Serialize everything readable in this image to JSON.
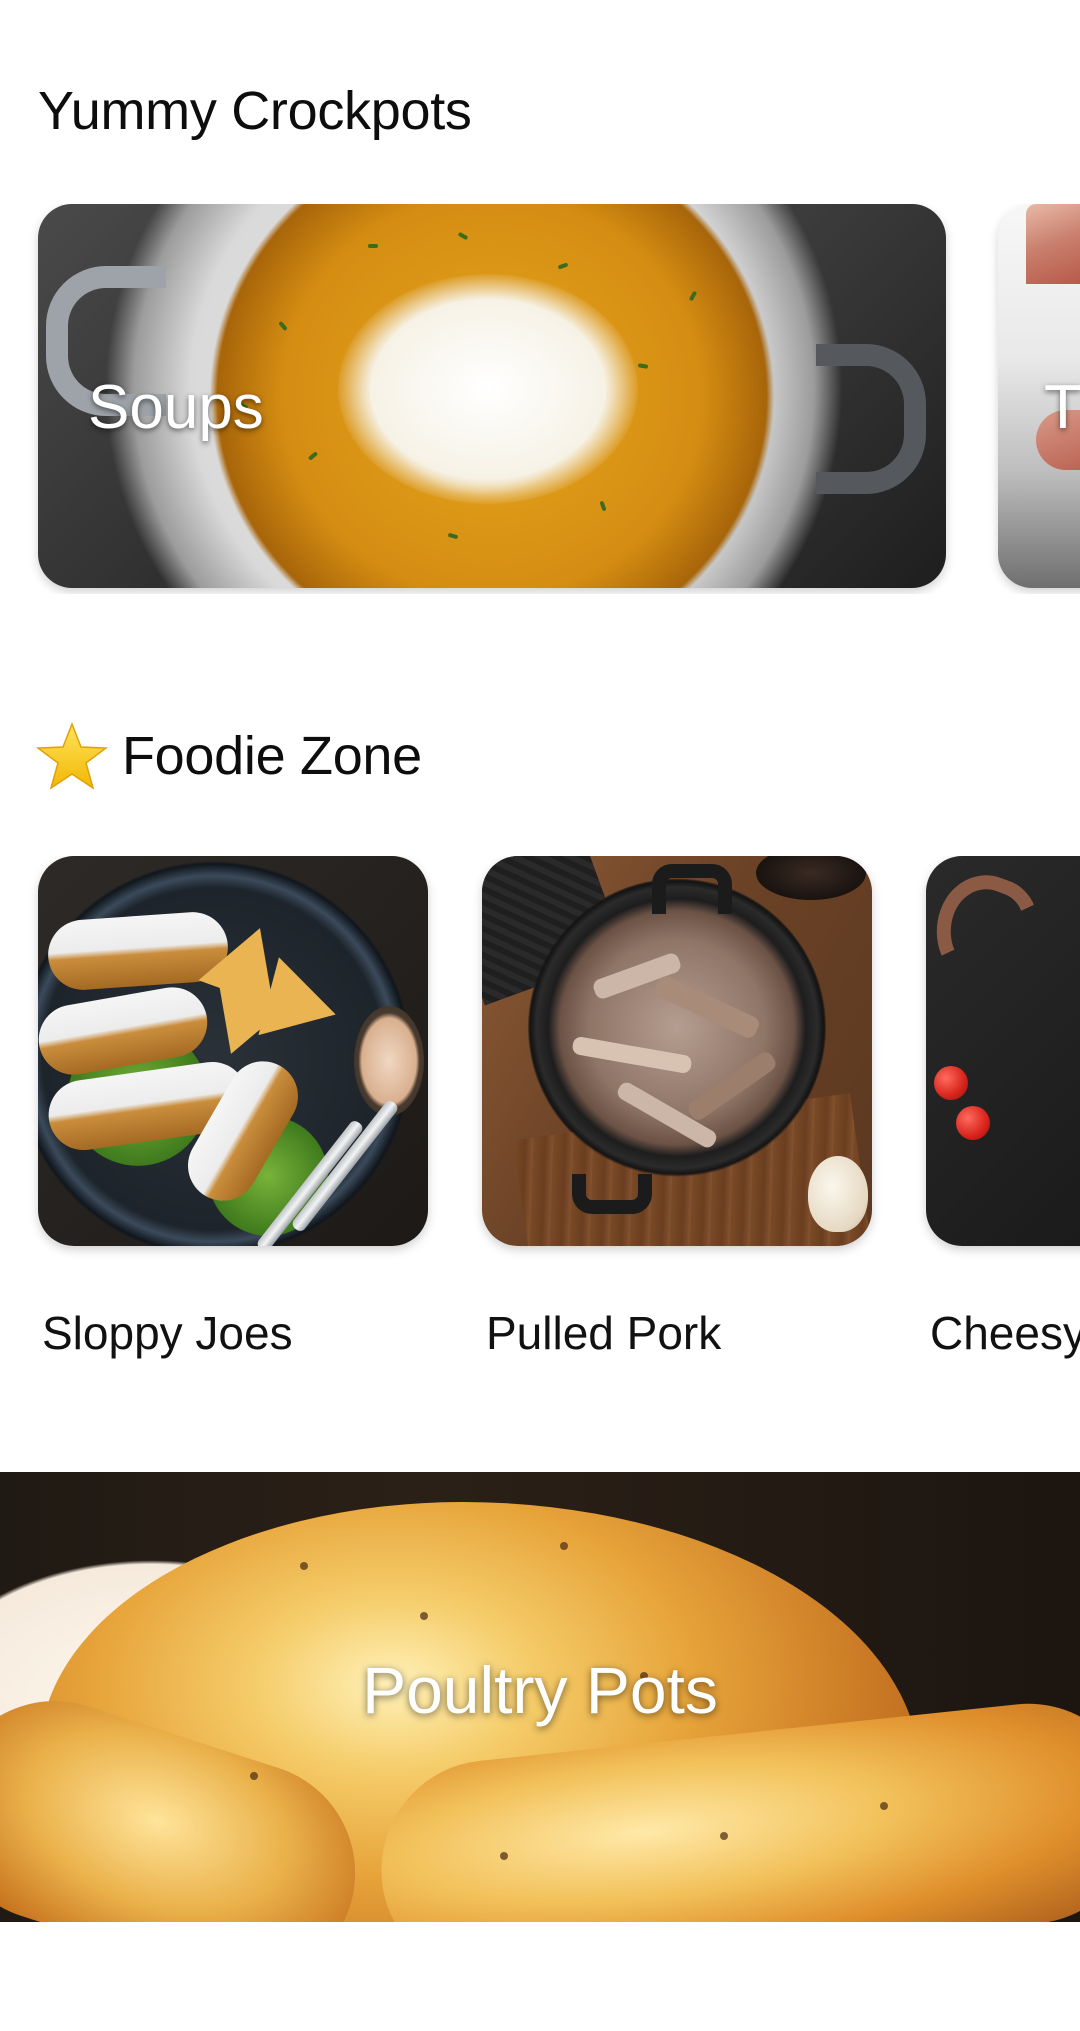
{
  "sections": {
    "crockpots": {
      "title": "Yummy Crockpots",
      "cards": [
        {
          "label": "Soups"
        },
        {
          "label": "T"
        }
      ]
    },
    "foodie": {
      "title": "Foodie Zone",
      "title_icon": "star-icon",
      "items": [
        {
          "name": "Sloppy Joes"
        },
        {
          "name": "Pulled Pork"
        },
        {
          "name": "Cheesy"
        }
      ]
    },
    "banner": {
      "label": "Poultry Pots"
    }
  },
  "colors": {
    "background": "#ffffff",
    "text": "#111111",
    "star": "#f6c21a"
  }
}
